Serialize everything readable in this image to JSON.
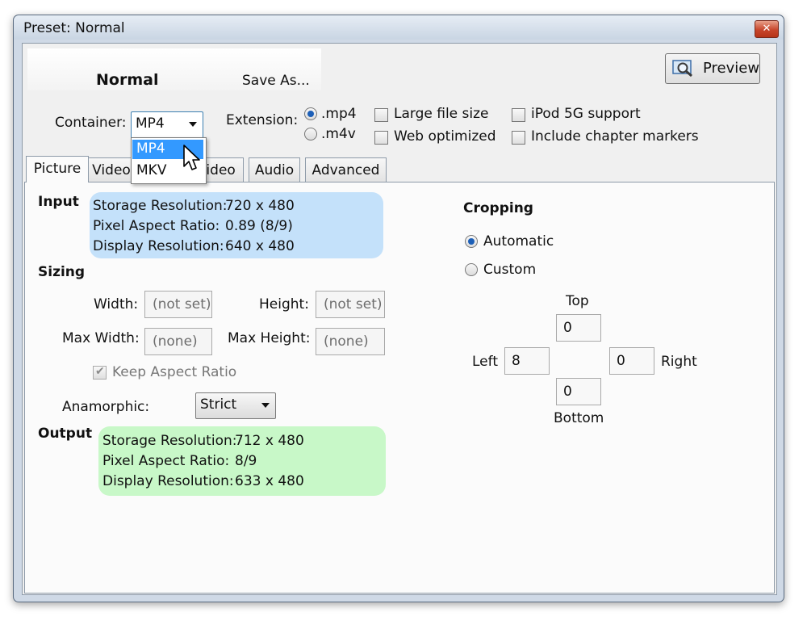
{
  "window": {
    "title": "Preset: Normal",
    "close_glyph": "✕"
  },
  "header": {
    "preset_name": "Normal",
    "save_as_label": "Save As...",
    "preview_label": "Preview",
    "preview_icon": "preview-magnifier-icon"
  },
  "container": {
    "label": "Container:",
    "selected": "MP4",
    "options": [
      "MP4",
      "MKV"
    ],
    "highlighted_option": "MP4"
  },
  "extension": {
    "label": "Extension:",
    "options": [
      {
        "label": ".mp4",
        "selected": true
      },
      {
        "label": ".m4v",
        "selected": false
      }
    ]
  },
  "options": {
    "large_file_size": {
      "label": "Large file size",
      "checked": false
    },
    "web_optimized": {
      "label": "Web optimized",
      "checked": false
    },
    "ipod_5g_support": {
      "label": "iPod 5G support",
      "checked": false
    },
    "include_chapter_markers": {
      "label": "Include chapter markers",
      "checked": false
    }
  },
  "tabs": [
    {
      "label": "Picture",
      "active": true
    },
    {
      "label": "Video",
      "active": false
    },
    {
      "label": "Video",
      "active": false
    },
    {
      "label": "Audio",
      "active": false
    },
    {
      "label": "Advanced",
      "active": false
    }
  ],
  "picture": {
    "input": {
      "heading": "Input",
      "storage_resolution": {
        "label": "Storage Resolution:",
        "value": "720 x 480"
      },
      "pixel_aspect_ratio": {
        "label": "Pixel Aspect Ratio:",
        "value": "0.89 (8/9)"
      },
      "display_resolution": {
        "label": "Display Resolution:",
        "value": "640 x 480"
      }
    },
    "sizing": {
      "heading": "Sizing",
      "width": {
        "label": "Width:",
        "value": "(not set)"
      },
      "height": {
        "label": "Height:",
        "value": "(not set)"
      },
      "max_width": {
        "label": "Max Width:",
        "value": "(none)"
      },
      "max_height": {
        "label": "Max Height:",
        "value": "(none)"
      },
      "keep_aspect_ratio": {
        "label": "Keep Aspect Ratio",
        "checked": true,
        "enabled": false
      },
      "anamorphic": {
        "label": "Anamorphic:",
        "value": "Strict"
      }
    },
    "output": {
      "heading": "Output",
      "storage_resolution": {
        "label": "Storage Resolution:",
        "value": "712 x 480"
      },
      "pixel_aspect_ratio": {
        "label": "Pixel Aspect Ratio:",
        "value": "8/9"
      },
      "display_resolution": {
        "label": "Display Resolution:",
        "value": "633 x 480"
      }
    },
    "cropping": {
      "heading": "Cropping",
      "automatic_label": "Automatic",
      "custom_label": "Custom",
      "mode": "Automatic",
      "top": {
        "label": "Top",
        "value": "0"
      },
      "left": {
        "label": "Left",
        "value": "8"
      },
      "right": {
        "label": "Right",
        "value": "0"
      },
      "bottom": {
        "label": "Bottom",
        "value": "0"
      }
    }
  },
  "colors": {
    "input_box": "#c4e1fa",
    "output_box": "#c8f8c8",
    "selection": "#3399ff",
    "radio_dot": "#1d5fb7"
  }
}
